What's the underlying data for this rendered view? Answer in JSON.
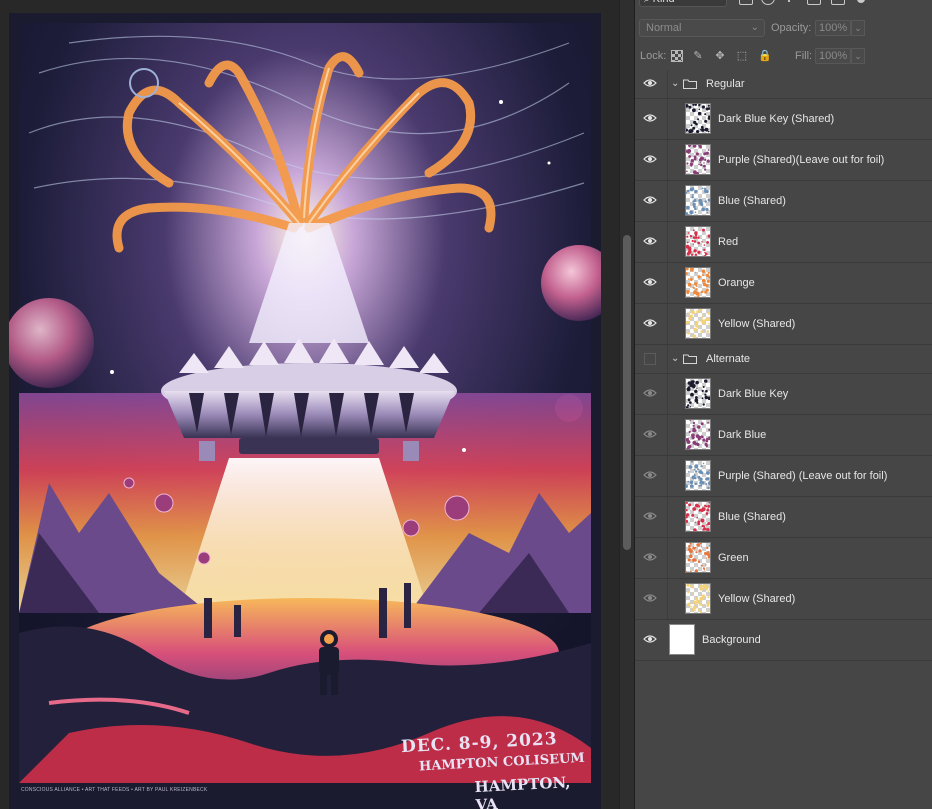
{
  "panel": {
    "filter_kind": "Kind",
    "blend_mode": "Normal",
    "opacity_label": "Opacity:",
    "opacity_value": "100%",
    "lock_label": "Lock:",
    "fill_label": "Fill:",
    "fill_value": "100%"
  },
  "groups": [
    {
      "name": "Regular",
      "visible": true,
      "layers": [
        {
          "name": "Dark Blue Key (Shared)",
          "visible": true,
          "thumb_color": "#1a1b2e"
        },
        {
          "name": "Purple (Shared)(Leave out for foil)",
          "visible": true,
          "thumb_color": "#8a3d78"
        },
        {
          "name": "Blue (Shared)",
          "visible": true,
          "thumb_color": "#6b8fb5"
        },
        {
          "name": "Red",
          "visible": true,
          "thumb_color": "#d9304a"
        },
        {
          "name": "Orange",
          "visible": true,
          "thumb_color": "#f08a3a"
        },
        {
          "name": "Yellow (Shared)",
          "visible": true,
          "thumb_color": "#f4d27a"
        }
      ]
    },
    {
      "name": "Alternate",
      "visible": false,
      "layers": [
        {
          "name": "Dark Blue Key",
          "visible": false,
          "thumb_color": "#1a1b2e"
        },
        {
          "name": "Dark Blue",
          "visible": false,
          "thumb_color": "#8a3d78"
        },
        {
          "name": "Purple (Shared) (Leave out for foil)",
          "visible": false,
          "thumb_color": "#6b8fb5"
        },
        {
          "name": "Blue (Shared)",
          "visible": false,
          "thumb_color": "#d9304a"
        },
        {
          "name": "Green",
          "visible": false,
          "thumb_color": "#e8753a"
        },
        {
          "name": "Yellow (Shared)",
          "visible": false,
          "thumb_color": "#f4d27a"
        }
      ]
    }
  ],
  "background_layer": {
    "name": "Background",
    "visible": true
  },
  "poster": {
    "date_line": "DEC. 8-9, 2023",
    "venue_line": "HAMPTON COLISEUM",
    "city_line": "HAMPTON, VA",
    "credit_line": "CONSCIOUS ALLIANCE • ART THAT FEEDS • ART BY PAUL KREIZENBECK"
  }
}
